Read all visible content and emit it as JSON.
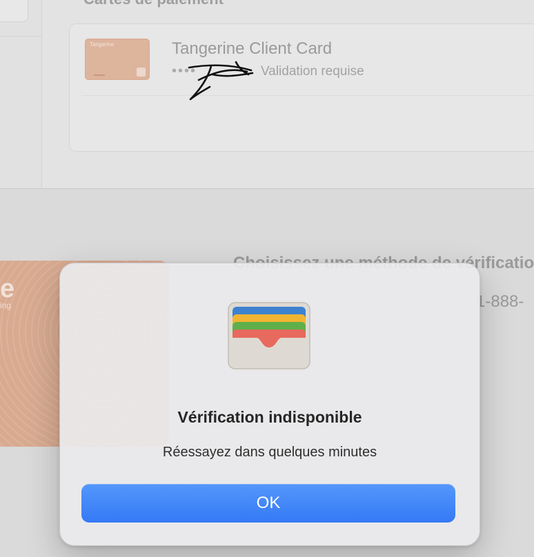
{
  "background": {
    "section_title": "Cartes de paiement",
    "card": {
      "thumb_brand": "Tangerine",
      "name": "Tangerine Client Card",
      "status_dots": "••••",
      "status": "Validation requise"
    },
    "verification": {
      "title": "Choisissez une méthode de vérification",
      "phone": "1-888-"
    },
    "big_card": {
      "letter": "e",
      "tag": "ing"
    }
  },
  "dialog": {
    "icon": "wallet-icon",
    "title": "Vérification indisponible",
    "message": "Réessayez dans quelques minutes",
    "ok_label": "OK",
    "accent": "#3a7ef7"
  }
}
